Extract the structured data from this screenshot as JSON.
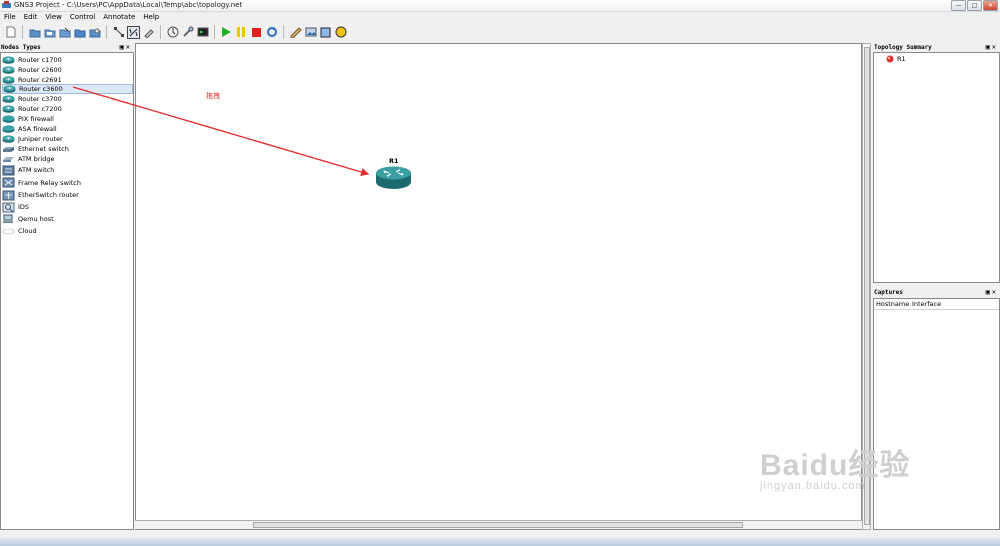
{
  "window": {
    "title": "GNS3 Project - C:\\Users\\PC\\AppData\\Local\\Temp\\abc\\topology.net",
    "controls": {
      "minimize": "—",
      "maximize": "□",
      "close": "✕"
    }
  },
  "menu": [
    "File",
    "Edit",
    "View",
    "Control",
    "Annotate",
    "Help"
  ],
  "toolbar": {
    "buttons": [
      "new-project-icon",
      "open-project-icon",
      "save-icon",
      "save-as-icon",
      "open-folder-icon",
      "snapshot-icon",
      "toggle-names-icon",
      "add-link-icon",
      "capture-icon",
      "console-icon",
      "telnet-all-icon",
      "terminal-icon",
      "start-all-icon",
      "suspend-all-icon",
      "stop-all-icon",
      "reload-all-icon",
      "add-note-icon",
      "insert-picture-icon",
      "draw-rectangle-icon",
      "draw-ellipse-icon"
    ],
    "colors": {
      "start": "#22b22a",
      "suspend": "#e6c700",
      "stop": "#e32020",
      "ellipse": "#f2c50c",
      "rectangle": "#8fb8e8"
    }
  },
  "nodes_panel": {
    "title": "Nodes Types",
    "items": [
      {
        "label": "Router c1700",
        "icon": "router-icon"
      },
      {
        "label": "Router c2600",
        "icon": "router-icon"
      },
      {
        "label": "Router c2691",
        "icon": "router-icon"
      },
      {
        "label": "Router c3600",
        "icon": "router-icon"
      },
      {
        "label": "Router c3700",
        "icon": "router-icon"
      },
      {
        "label": "Router c7200",
        "icon": "router-icon"
      },
      {
        "label": "PIX firewall",
        "icon": "firewall-icon"
      },
      {
        "label": "ASA firewall",
        "icon": "firewall-icon"
      },
      {
        "label": "Juniper router",
        "icon": "router-icon"
      },
      {
        "label": "Ethernet switch",
        "icon": "ethernet-switch-icon"
      },
      {
        "label": "ATM bridge",
        "icon": "atm-bridge-icon"
      },
      {
        "label": "ATM switch",
        "icon": "atm-switch-icon"
      },
      {
        "label": "Frame Relay switch",
        "icon": "frame-relay-switch-icon"
      },
      {
        "label": "EtherSwitch router",
        "icon": "etherswitch-router-icon"
      },
      {
        "label": "IDS",
        "icon": "ids-icon"
      },
      {
        "label": "Qemu host",
        "icon": "host-icon"
      },
      {
        "label": "Cloud",
        "icon": "cloud-icon"
      }
    ],
    "selected": "Router c3600"
  },
  "canvas": {
    "annotation": "拖拽",
    "node": {
      "label": "R1"
    }
  },
  "topology_panel": {
    "title": "Topology Summary",
    "items": [
      {
        "label": "R1",
        "status_color": "#e03030"
      }
    ]
  },
  "captures_panel": {
    "title": "Captures",
    "columns": [
      "Hostname",
      "Interface"
    ]
  },
  "watermark": {
    "main": "Baidu经验",
    "sub": "jingyan.baidu.com"
  }
}
